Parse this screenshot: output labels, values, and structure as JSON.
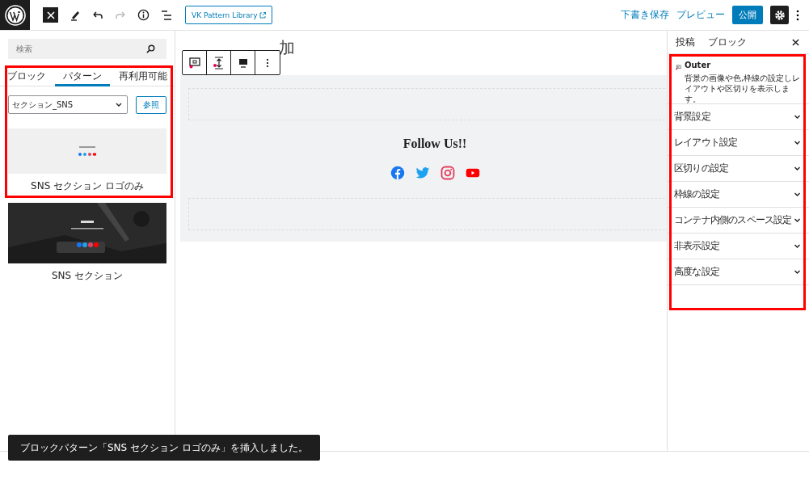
{
  "topbar": {
    "link_button": "VK Pattern Library",
    "save_draft": "下書き保存",
    "preview": "プレビュー",
    "publish": "公開"
  },
  "inserter": {
    "search": {
      "placeholder": "検索"
    },
    "tabs": [
      {
        "label": "ブロック",
        "selected": false
      },
      {
        "label": "パターン",
        "selected": true
      },
      {
        "label": "再利用可能",
        "selected": false
      }
    ],
    "category": {
      "value": "セクション_SNS"
    },
    "browse": "参照",
    "patterns": [
      {
        "label": "SNS セクション ロゴのみ",
        "kind": "light"
      },
      {
        "label": "SNS セクション",
        "kind": "dark"
      }
    ]
  },
  "editor": {
    "title_placeholder": "加",
    "heading": "Follow Us!!",
    "social": [
      {
        "kind": "facebook"
      },
      {
        "kind": "twitter"
      },
      {
        "kind": "instagram"
      },
      {
        "kind": "youtube"
      }
    ]
  },
  "sidebar": {
    "tabs": [
      {
        "label": "投稿"
      },
      {
        "label": "ブロック"
      }
    ],
    "block": {
      "name": "Outer",
      "description": "背景の画像や色,枠線の設定しレイアウトや区切りを表示します。"
    },
    "panels": [
      {
        "label": "背景設定",
        "expanded": false
      },
      {
        "label": "レイアウト設定",
        "expanded": false
      },
      {
        "label": "区切りの設定",
        "expanded": false
      },
      {
        "label": "枠線の設定",
        "expanded": false
      },
      {
        "label": "コンテナ内側のスペース設定",
        "expanded": false
      },
      {
        "label": "非表示設定",
        "expanded": false
      },
      {
        "label": "高度な設定",
        "expanded": false
      }
    ]
  },
  "toast": "ブロックパターン「SNS セクション ロゴのみ」を挿入しました。"
}
